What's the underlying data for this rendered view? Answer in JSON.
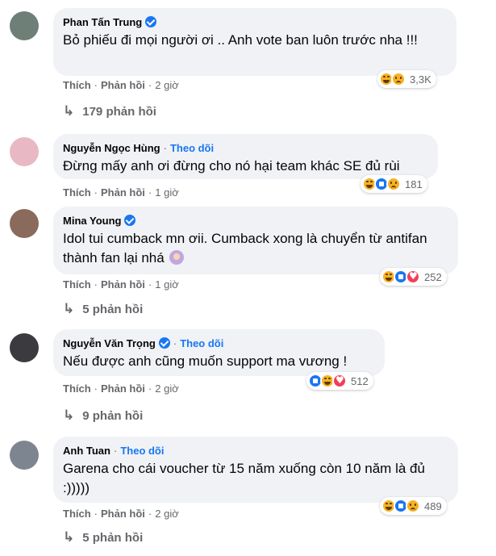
{
  "comments": [
    {
      "name": "Phan Tấn Trung",
      "verified": true,
      "follow": "",
      "text": "Bỏ phiếu đi mọi người ơi .. Anh vote ban luôn trước nha !!!",
      "like": "Thích",
      "reply": "Phản hồi",
      "time": "2 giờ",
      "reaction_icons": [
        "haha-icon",
        "sad-icon"
      ],
      "reaction_count": "3,3K",
      "replies": "179 phản hồi",
      "avatar_color": "#6d7f76"
    },
    {
      "name": "Nguyễn Ngọc Hùng",
      "verified": false,
      "follow": "Theo dõi",
      "text": "Đừng mấy anh ơi đừng cho nó hại team khác SE đủ rùi",
      "like": "Thích",
      "reply": "Phản hồi",
      "time": "1 giờ",
      "reaction_icons": [
        "haha-icon",
        "like-icon",
        "sad-icon"
      ],
      "reaction_count": "181",
      "replies": "",
      "avatar_color": "#e8b9c4"
    },
    {
      "name": "Mina Young",
      "verified": true,
      "follow": "",
      "text": "Idol tui cumback mn ơii. Cumback xong là chuyển từ antifan thành fan lại nhá",
      "like": "Thích",
      "reply": "Phản hồi",
      "time": "1 giờ",
      "reaction_icons": [
        "haha-icon",
        "like-icon",
        "love-icon"
      ],
      "reaction_count": "252",
      "replies": "5 phản hồi",
      "avatar_color": "#8a6a5a"
    },
    {
      "name": "Nguyễn Văn Trọng",
      "verified": true,
      "follow": "Theo dõi",
      "text": "Nếu được anh cũng muốn support ma vương !",
      "like": "Thích",
      "reply": "Phản hồi",
      "time": "2 giờ",
      "reaction_icons": [
        "like-icon",
        "haha-icon",
        "love-icon"
      ],
      "reaction_count": "512",
      "replies": "9 phản hồi",
      "avatar_color": "#3b3b3f"
    },
    {
      "name": "Anh Tuan",
      "verified": false,
      "follow": "Theo dõi",
      "text": "Garena cho cái voucher từ 15 năm xuống còn 10 năm là đủ :)))))",
      "like": "Thích",
      "reply": "Phản hồi",
      "time": "2 giờ",
      "reaction_icons": [
        "haha-icon",
        "like-icon",
        "sad-icon"
      ],
      "reaction_count": "489",
      "replies": "5 phản hồi",
      "avatar_color": "#7c8590"
    }
  ]
}
